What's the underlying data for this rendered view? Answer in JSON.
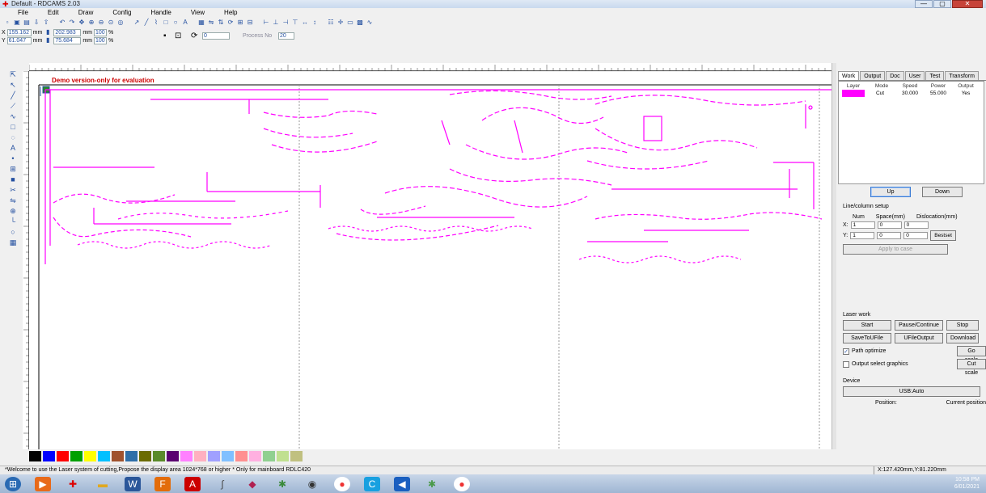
{
  "window": {
    "title": "Default - RDCAMS 2.03",
    "center_text": "",
    "buttons": [
      "—",
      "▢",
      "✕"
    ]
  },
  "menu": [
    "File",
    "Edit",
    "Draw",
    "Config",
    "Handle",
    "View",
    "Help"
  ],
  "coords": {
    "x_value": "155.162",
    "y_value": "61.047",
    "x_unit": "mm",
    "y_unit": "mm",
    "w_value": "202.983",
    "h_value": "75.684",
    "w_unit": "mm",
    "h_unit": "mm",
    "scale_x": "100",
    "scale_y": "100",
    "pct": "%",
    "rotate_value": "0",
    "process_label": "Process No",
    "process_value": "20"
  },
  "canvas": {
    "demo_text": "Demo version-only for evaluation"
  },
  "panel": {
    "tabs": [
      "Work",
      "Output",
      "Doc",
      "User",
      "Test",
      "Transform"
    ],
    "layer_headers": [
      "Layer",
      "Mode",
      "Speed",
      "Power",
      "Output"
    ],
    "layer_row": {
      "mode": "Cut",
      "speed": "30.000",
      "power": "55.000",
      "output": "Yes"
    },
    "up_label": "Up",
    "down_label": "Down",
    "line_col": {
      "title": "Line/column setup",
      "headers": [
        "Num",
        "Space(mm)",
        "Dislocation(mm)"
      ],
      "x_label": "X:",
      "y_label": "Y:",
      "x_num": "1",
      "y_num": "1",
      "x_space": "0",
      "y_space": "0",
      "x_disloc": "0",
      "y_disloc": "0",
      "bestset": "Bestset",
      "apply": "Apply to case"
    },
    "laser_work": {
      "title": "Laser work",
      "buttons": [
        "Start",
        "Pause/Continue",
        "Stop",
        "SaveToUFile",
        "UFileOutput",
        "Download",
        "Go scale",
        "Cut scale"
      ],
      "path_optimize": "Path optimize",
      "output_select": "Output select graphics"
    },
    "device": {
      "title": "Device",
      "port": "USB:Auto",
      "position_label": "Position:",
      "position_value": "Current position"
    }
  },
  "palette_colors": [
    "#000000",
    "#0000ff",
    "#ff0000",
    "#00a000",
    "#ffff00",
    "#00c0ff",
    "#a0522d",
    "#2f6fa8",
    "#6b6b00",
    "#5a8a2a",
    "#5a0070",
    "#ff80ff",
    "#ffb0c0",
    "#a0a0ff",
    "#80c0ff",
    "#ff9090",
    "#ffb0e0",
    "#90d090",
    "#c0e090",
    "#c0c080"
  ],
  "status": {
    "message": "*Welcome to use the Laser system of cutting,Propose the display area 1024*768 or higher *   Only for mainboard RDLC420",
    "position": "X:127.420mm,Y:81.220mm"
  },
  "taskbar": {
    "time": "10:58 PM",
    "date": "6/01/2021"
  },
  "colors": {
    "accent": "#ff00ff",
    "demo_text": "#cc0000"
  }
}
